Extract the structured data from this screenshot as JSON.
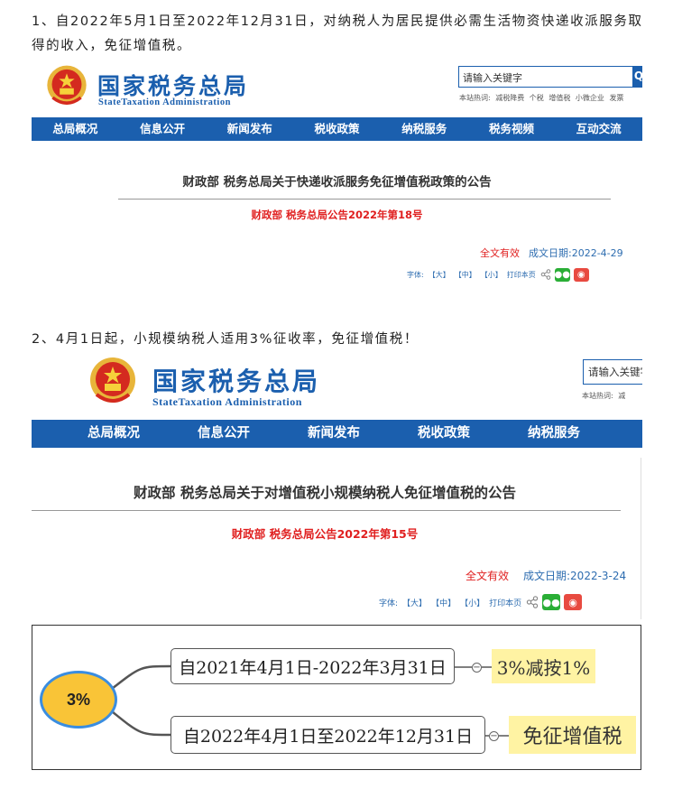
{
  "para1": "1、自2022年5月1日至2022年12月31日，对纳税人为居民提供必需生活物资快递收派服务取得的收入，免征增值税。",
  "para2": "2、4月1日起，小规模纳税人适用3%征收率，免征增值税！",
  "site": {
    "brand_cn": "国家税务总局",
    "brand_en": "StateTaxation Administration",
    "search_placeholder": "请输入关键字",
    "search_button": "Q",
    "hot_label": "本站热词:",
    "hot_words": [
      "减税降费",
      "个税",
      "增值税",
      "小微企业",
      "发票"
    ],
    "hot_words_short": "减"
  },
  "notice1": {
    "nav": [
      "总局概况",
      "信息公开",
      "新闻发布",
      "税收政策",
      "纳税服务",
      "税务视频",
      "互动交流"
    ],
    "title": "财政部 税务总局关于快递收派服务免征增值税政策的公告",
    "docno": "财政部 税务总局公告2022年第18号",
    "status": "全文有效",
    "date": "成文日期:2022-4-29",
    "font_label": "字体:",
    "font_large": "【大】",
    "font_medium": "【中】",
    "font_small": "【小】",
    "print": "打印本页"
  },
  "notice2": {
    "nav": [
      "总局概况",
      "信息公开",
      "新闻发布",
      "税收政策",
      "纳税服务"
    ],
    "search_placeholder": "请输入关键字",
    "title": "财政部 税务总局关于对增值税小规模纳税人免征增值税的公告",
    "docno": "财政部 税务总局公告2022年第15号",
    "status": "全文有效",
    "date": "成文日期:2022-3-24",
    "font_label": "字体:",
    "font_large": "【大】",
    "font_medium": "【中】",
    "font_small": "【小】",
    "print": "打印本页"
  },
  "mindmap": {
    "root": "3%",
    "branches": [
      {
        "period": "自2021年4月1日-2022年3月31日",
        "policy": "3%减按1%"
      },
      {
        "period": "自2022年4月1日至2022年12月31日",
        "policy": "免征增值税"
      }
    ]
  },
  "colors": {
    "brand_blue": "#1b5fae",
    "docno_red": "#e02020",
    "date_blue": "#2e6db0",
    "root_fill": "#f9c437",
    "leaf_fill": "#fff3a3"
  }
}
